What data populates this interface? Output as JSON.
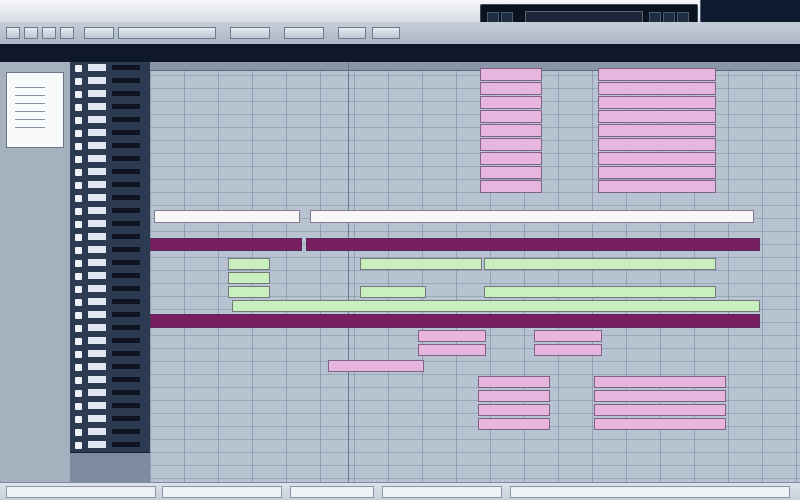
{
  "window": {
    "title": "",
    "right_panel_label": ""
  },
  "toolbar": {
    "buttons": [
      {
        "label": ""
      },
      {
        "label": ""
      },
      {
        "label": ""
      },
      {
        "label": ""
      },
      {
        "label": ""
      },
      {
        "label": ""
      },
      {
        "label": ""
      },
      {
        "label": ""
      },
      {
        "label": ""
      },
      {
        "label": ""
      }
    ]
  },
  "transport": {
    "display_value": ""
  },
  "strip": {
    "label": ""
  },
  "inspector": {
    "panel_title": ""
  },
  "tracks": [
    {
      "name": ""
    },
    {
      "name": ""
    },
    {
      "name": ""
    },
    {
      "name": ""
    },
    {
      "name": ""
    },
    {
      "name": ""
    },
    {
      "name": ""
    },
    {
      "name": ""
    },
    {
      "name": ""
    },
    {
      "name": ""
    },
    {
      "name": ""
    },
    {
      "name": ""
    },
    {
      "name": ""
    },
    {
      "name": ""
    },
    {
      "name": ""
    },
    {
      "name": ""
    },
    {
      "name": ""
    },
    {
      "name": ""
    },
    {
      "name": ""
    },
    {
      "name": ""
    },
    {
      "name": ""
    },
    {
      "name": ""
    },
    {
      "name": ""
    },
    {
      "name": ""
    },
    {
      "name": ""
    },
    {
      "name": ""
    },
    {
      "name": ""
    },
    {
      "name": ""
    },
    {
      "name": ""
    },
    {
      "name": ""
    }
  ],
  "events": [
    {
      "label": ""
    },
    {
      "label": ""
    },
    {
      "label": ""
    },
    {
      "label": ""
    },
    {
      "label": ""
    },
    {
      "label": ""
    },
    {
      "label": ""
    },
    {
      "label": ""
    },
    {
      "label": ""
    },
    {
      "label": ""
    },
    {
      "label": ""
    },
    {
      "label": ""
    },
    {
      "label": ""
    },
    {
      "label": ""
    },
    {
      "label": ""
    },
    {
      "label": ""
    },
    {
      "label": ""
    },
    {
      "label": ""
    },
    {
      "label": ""
    },
    {
      "label": ""
    },
    {
      "label": ""
    },
    {
      "label": ""
    },
    {
      "label": ""
    },
    {
      "label": ""
    },
    {
      "label": ""
    },
    {
      "label": ""
    },
    {
      "label": ""
    },
    {
      "label": ""
    },
    {
      "label": ""
    },
    {
      "label": ""
    }
  ],
  "status": {
    "items": [
      {
        "label": ""
      },
      {
        "label": ""
      },
      {
        "label": ""
      },
      {
        "label": ""
      },
      {
        "label": ""
      }
    ]
  },
  "colors": {
    "pink_event": "#e7b6df",
    "dark_magenta_event": "#7a1e62",
    "green_event": "#c8efbd",
    "white_event": "#f7f7f7"
  }
}
